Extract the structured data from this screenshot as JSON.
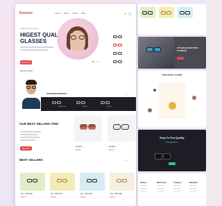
{
  "brand": {
    "logo": "Eyecare"
  },
  "nav": {
    "items": [
      "Home",
      "Shop",
      "About",
      "Blog",
      "Contact"
    ]
  },
  "hero": {
    "tag": "Welcome to our store",
    "title": "HIGEST QUALITY GLASSES",
    "button": "Shop Now",
    "link": "Discover More"
  },
  "featured": {
    "label": "FEATURED PRODUCT",
    "items": [
      "Sunglasses",
      "Aviator",
      "Classic"
    ]
  },
  "best_item": {
    "title": "OUR BEST SELLING ITEM",
    "button": "Buy Now",
    "products": [
      {
        "name": "Sunglass",
        "price": "$59.00"
      },
      {
        "name": "Eyeglass",
        "price": "$59.00"
      }
    ]
  },
  "best_sellers": {
    "title": "BEST SELLERS",
    "products": [
      {
        "name": "Eye - 2019 Sale",
        "price": "$29.00"
      },
      {
        "name": "Eye - 2019 Sale",
        "price": "$29.00"
      },
      {
        "name": "Eye - 2019 Sale",
        "price": "$29.00"
      },
      {
        "name": "Eye - 2019 Sale",
        "price": "$29.00"
      }
    ]
  },
  "right": {
    "promo_title": "STYLISH & BEAUTIFUL EYEWEAR",
    "happy_client": "OUR HAPPY CLIENT",
    "dark_title": "Easy To Find Quality",
    "dark_sub": "Eyeglasses",
    "footer_cols": [
      "Address",
      "Quick Links",
      "Company",
      "Newsletter"
    ]
  },
  "colors": {
    "accent": "#e0474b",
    "dark": "#1d1d25",
    "green": "#2ec78e",
    "navy": "#0e1e3a"
  }
}
